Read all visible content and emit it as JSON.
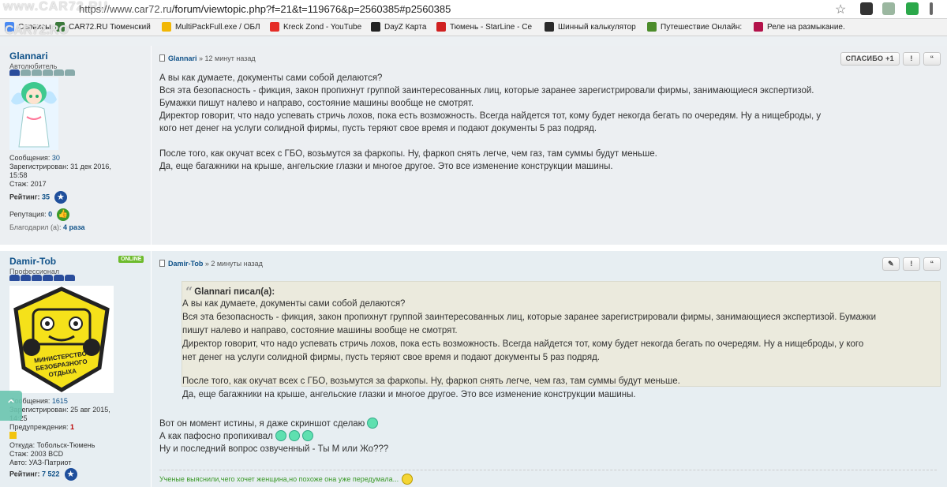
{
  "browser": {
    "url_prefix": "https://www.car72.ru",
    "url_path": "/forum/viewtopic.php?f=21&t=119676&p=2560385#p2560385",
    "watermark": "www.CAR72.RU",
    "watermark2": "CAR72.RO",
    "bookmarks": [
      {
        "label": "Сервисы",
        "color": "#4a8af4"
      },
      {
        "label": "CAR72.RU Тюменский",
        "color": "#3b7a3b"
      },
      {
        "label": "MultiPackFull.exe / ОБЛ",
        "color": "#f2b705"
      },
      {
        "label": "Kreck Zond - YouTube",
        "color": "#e52d27"
      },
      {
        "label": "DayZ Карта",
        "color": "#222222"
      },
      {
        "label": "Тюмень - StarLine - Се",
        "color": "#d02020"
      },
      {
        "label": "Шинный калькулятор",
        "color": "#2a2a2a"
      },
      {
        "label": "Путешествие Онлайн:",
        "color": "#4c8c2b"
      },
      {
        "label": "Реле на размыкание.",
        "color": "#b3124a"
      }
    ]
  },
  "post1": {
    "username": "Glannari",
    "rank": "Автолюбитель",
    "stats": {
      "messages_label": "Сообщения:",
      "messages": "30",
      "registered_label": "Зарегистрирован:",
      "registered": "31 дек 2016,",
      "registered_time": "15:58",
      "experience_label": "Стаж:",
      "experience": "2017",
      "rating_label": "Рейтинг:",
      "rating": "35",
      "reputation_label": "Репутация:",
      "reputation": "0",
      "thanked_label": "Благодарил (а):",
      "thanked": "4 раза"
    },
    "author": "Glannari",
    "time": "» 12 минут назад",
    "buttons": {
      "thanks": "СПАСИБО +1",
      "report": "!",
      "quote": "“"
    },
    "lines": [
      "А вы как думаете, документы сами собой делаются?",
      "Вся эта безопасность - фикция, закон пропихнут группой заинтересованных лиц, которые заранее зарегистрировали фирмы, занимающиеся экспертизой.",
      "Бумажки пишут налево и направо, состояние машины вообще не смотрят.",
      "Директор говорит, что надо успевать стричь лохов, пока есть возможность. Всегда найдется тот, кому будет некогда бегать по очередям. Ну а нищеброды, у",
      "кого нет денег на услуги солидной фирмы, пусть теряют свое время и подают документы 5 раз подряд.",
      "",
      "После того, как окучат всех с ГБО, возьмутся за фаркопы. Ну, фаркоп снять легче, чем газ, там суммы будут меньше.",
      "Да, еще багажники на крыше, ангельские глазки и многое другое. Это все изменение конструкции машины."
    ]
  },
  "post2": {
    "username": "Damir-Tob",
    "online": "ONLINE",
    "rank": "Профессионал",
    "avatar_text": [
      "МИНИСТЕРСТВО",
      "БЕЗОБРАЗНОГО",
      "ОТДЫХА"
    ],
    "stats": {
      "messages_label": "Сообщения:",
      "messages": "1615",
      "registered_label": "Зарегистрирован:",
      "registered": "25 авг 2015,",
      "registered_time": "14:25",
      "warnings_label": "Предупреждения:",
      "warnings": "1",
      "from_label": "Откуда:",
      "from": "Тобольск-Тюмень",
      "experience_label": "Стаж:",
      "experience": "2003 BCD",
      "car_label": "Авто:",
      "car": "УАЗ-Патриот",
      "rating_label": "Рейтинг:",
      "rating": "7 522"
    },
    "author": "Damir-Tob",
    "time": "» 2 минуты назад",
    "buttons": {
      "edit": "✎",
      "report": "!",
      "quote": "“"
    },
    "quote_head": "Glannari писал(а):",
    "quote_lines": [
      "А вы как думаете, документы сами собой делаются?",
      "Вся эта безопасность - фикция, закон пропихнут группой заинтересованных лиц, которые заранее зарегистрировали фирмы, занимающиеся экспертизой. Бумажки",
      "пишут налево и направо, состояние машины вообще не смотрят.",
      "Директор говорит, что надо успевать стричь лохов, пока есть возможность. Всегда найдется тот, кому будет некогда бегать по очередям. Ну а нищеброды, у кого",
      "нет денег на услуги солидной фирмы, пусть теряют свое время и подают документы 5 раз подряд.",
      "",
      "После того, как окучат всех с ГБО, возьмутся за фаркопы. Ну, фаркоп снять легче, чем газ, там суммы будут меньше.",
      "Да, еще багажники на крыше, ангельские глазки и многое другое. Это все изменение конструкции машины."
    ],
    "reply_lines": [
      "Вот он момент истины, я даже скриншот сделаю",
      "А как пафосно пропихивал",
      "Ну и последний вопрос озвученный - Ты М или Жо???"
    ],
    "signature": "Ученые выяснили,чего хочет женщина,но похоже она уже передумала..."
  }
}
